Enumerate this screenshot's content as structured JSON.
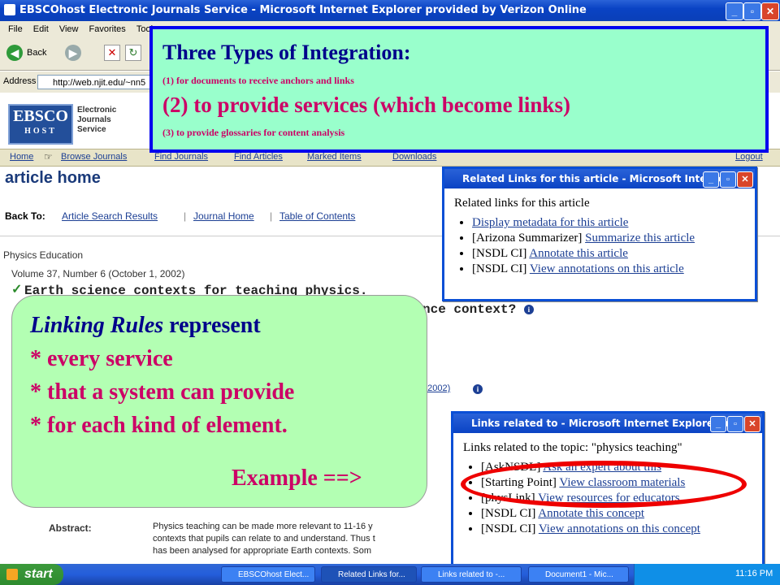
{
  "window": {
    "title": "EBSCOhost Electronic Journals Service - Microsoft Internet Explorer provided by Verizon Online",
    "menu": [
      "File",
      "Edit",
      "View",
      "Favorites",
      "Tools"
    ],
    "back_label": "Back",
    "address_label": "Address",
    "address_value": "http://web.njit.edu/~nn5"
  },
  "ebsco": {
    "logo_top": "EBSCO",
    "logo_bottom": "HOST",
    "logo_text": [
      "Electronic",
      "Journals",
      "Service"
    ],
    "nav": [
      "Home",
      "Browse Journals",
      "Find Journals",
      "Find Articles",
      "Marked Items",
      "Downloads",
      "Logout"
    ],
    "page_title": "article home",
    "back_to_label": "Back To:",
    "back_to_links": [
      "Article Search Results",
      "Journal Home",
      "Table of Contents"
    ],
    "journal": "Physics Education",
    "volume": "Volume 37, Number 6 (October 1, 2002)",
    "article_title_1": "Earth science contexts for teaching physics.",
    "article_title_2": "nce context?",
    "date_fragment": ". 2002)",
    "abstract_label": "Abstract:",
    "abstract_lines": [
      "Physics teaching can be made more relevant to 11-16 y",
      "contexts that pupils can relate to and understand. Thus t",
      "has been analysed for appropriate Earth contexts. Som"
    ]
  },
  "popup1": {
    "title": "Related Links for this article - Microsoft Interne...",
    "heading": "Related links for this article",
    "items": [
      {
        "prefix": "",
        "link": "Display metadata for this article"
      },
      {
        "prefix": "[Arizona Summarizer] ",
        "link": "Summarize this article"
      },
      {
        "prefix": "[NSDL CI] ",
        "link": "Annotate this article"
      },
      {
        "prefix": "[NSDL CI] ",
        "link": "View annotations on this article"
      }
    ]
  },
  "popup2": {
    "title": "Links related to - Microsoft Internet Explorer pr...",
    "heading": "Links related to the topic: \"physics teaching\"",
    "items": [
      {
        "prefix": "[AskNSDL] ",
        "link": "Ask an expert about this"
      },
      {
        "prefix": "[Starting Point] ",
        "link": "View classroom materials"
      },
      {
        "prefix": "[physLink] ",
        "link": "View resources for educators"
      },
      {
        "prefix": "[NSDL CI] ",
        "link": "Annotate this concept"
      },
      {
        "prefix": "[NSDL CI] ",
        "link": "View annotations on this concept"
      }
    ]
  },
  "integration": {
    "heading": "Three Types of Integration:",
    "line1": "(1) for documents to receive anchors and links",
    "line2": "(2) to provide services (which become links)",
    "line3": "(3) to provide glossaries  for content analysis"
  },
  "linking": {
    "italic_part": "Linking Rules",
    "rest_part": " represent",
    "line2": "* every service",
    "line3": "* that a system can provide",
    "line4": "* for each kind of element.",
    "example": "Example  ==>"
  },
  "taskbar": {
    "start": "start",
    "tasks": [
      "EBSCOhost Elect...",
      "Related Links for...",
      "Links related to -...",
      "Document1 - Mic..."
    ],
    "clock": "11:16 PM"
  },
  "colors": {
    "integration_bg": "#99ffcc",
    "integration_border": "#0000ee",
    "linking_bg": "#b3ffb3",
    "heading_navy": "#00008b",
    "magenta": "#cc0066",
    "oval_red": "#ee0000"
  }
}
